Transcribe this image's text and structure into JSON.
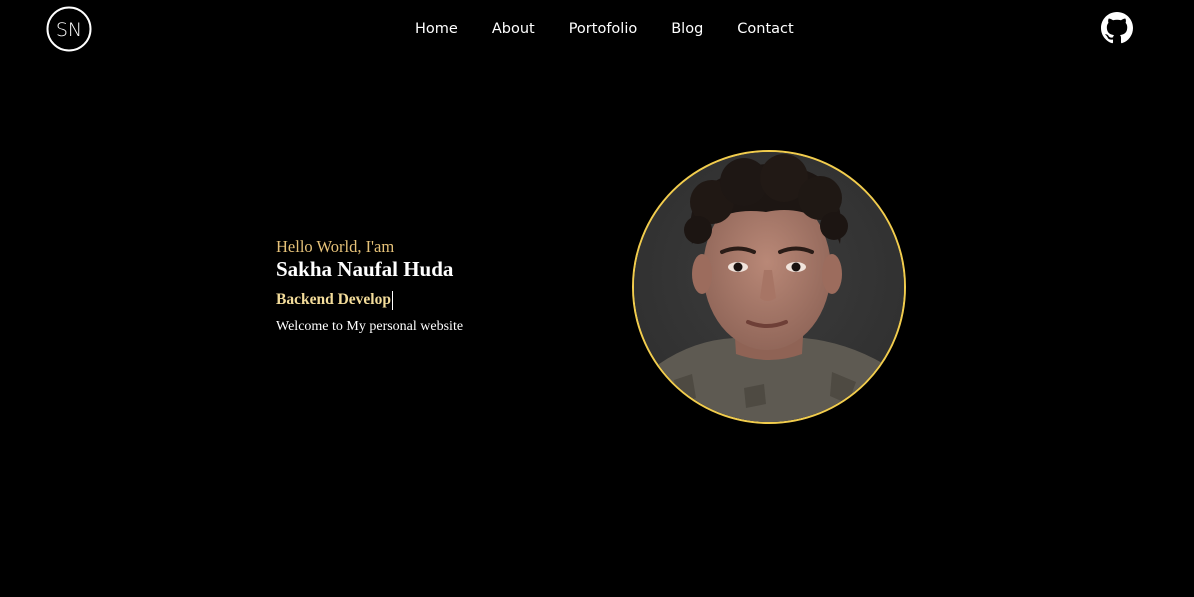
{
  "brand": {
    "logo_text": "SN"
  },
  "nav": {
    "items": [
      {
        "label": "Home"
      },
      {
        "label": "About"
      },
      {
        "label": "Portofolio"
      },
      {
        "label": "Blog"
      },
      {
        "label": "Contact"
      }
    ]
  },
  "social": {
    "icon": "github-icon"
  },
  "hero": {
    "greeting": "Hello World, I'am",
    "name": "Sakha Naufal Huda",
    "typed_role": "Backend Develop",
    "welcome": "Welcome to My personal website"
  },
  "avatar": {
    "icon": "profile-photo"
  },
  "colors": {
    "background": "#000000",
    "accent_gold": "#e6c279",
    "role_gold": "#f3dc9a",
    "avatar_ring": "#f2cd4d",
    "text": "#ffffff"
  }
}
